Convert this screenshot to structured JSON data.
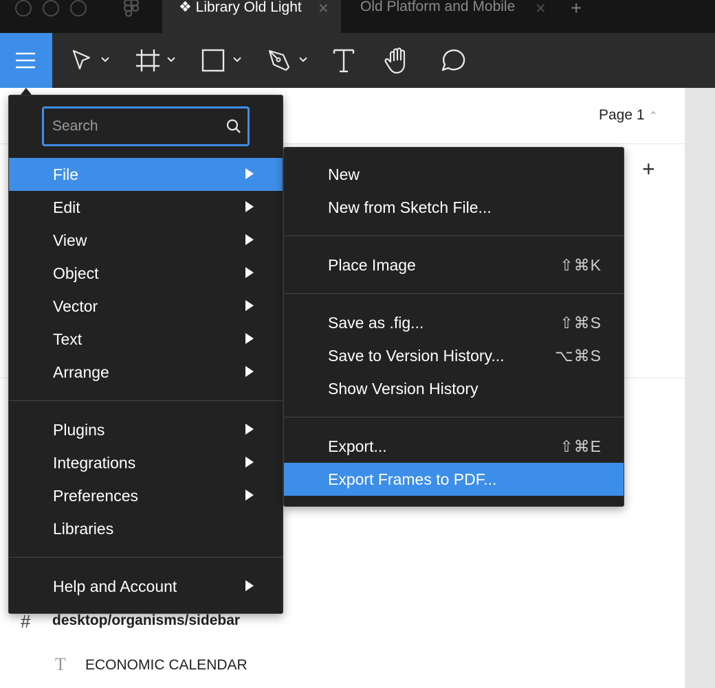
{
  "tabs": [
    {
      "label": "❖ Library Old Light",
      "active": true
    },
    {
      "label": "Old Platform and Mobile",
      "active": false
    }
  ],
  "tab_close_glyph": "✕",
  "new_tab_glyph": "+",
  "toolbar": {
    "tools": [
      "main-menu-icon",
      "move-tool-icon",
      "frame-tool-icon",
      "rectangle-tool-icon",
      "pen-tool-icon",
      "text-tool-icon",
      "hand-tool-icon",
      "comment-tool-icon"
    ],
    "text_tool_glyph": "T"
  },
  "pages": {
    "current": "Page 1",
    "caret": "⌃",
    "add_glyph": "+"
  },
  "search": {
    "placeholder": "Search"
  },
  "main_menu": {
    "groups": [
      [
        {
          "label": "File",
          "has_submenu": true,
          "active": true
        },
        {
          "label": "Edit",
          "has_submenu": true
        },
        {
          "label": "View",
          "has_submenu": true
        },
        {
          "label": "Object",
          "has_submenu": true
        },
        {
          "label": "Vector",
          "has_submenu": true
        },
        {
          "label": "Text",
          "has_submenu": true
        },
        {
          "label": "Arrange",
          "has_submenu": true
        }
      ],
      [
        {
          "label": "Plugins",
          "has_submenu": true
        },
        {
          "label": "Integrations",
          "has_submenu": true
        },
        {
          "label": "Preferences",
          "has_submenu": true
        },
        {
          "label": "Libraries",
          "has_submenu": false
        }
      ],
      [
        {
          "label": "Help and Account",
          "has_submenu": true
        }
      ]
    ]
  },
  "file_menu": {
    "groups": [
      [
        {
          "label": "New",
          "shortcut": ""
        },
        {
          "label": "New from Sketch File...",
          "shortcut": ""
        }
      ],
      [
        {
          "label": "Place Image",
          "shortcut": "⇧⌘K"
        }
      ],
      [
        {
          "label": "Save as .fig...",
          "shortcut": "⇧⌘S"
        },
        {
          "label": "Save to Version History...",
          "shortcut": "⌥⌘S"
        },
        {
          "label": "Show Version History",
          "shortcut": ""
        }
      ],
      [
        {
          "label": "Export...",
          "shortcut": "⇧⌘E"
        },
        {
          "label": "Export Frames to PDF...",
          "shortcut": "",
          "active": true
        }
      ]
    ]
  },
  "layers": {
    "frame": {
      "icon": "#",
      "label": "desktop/organisms/sidebar"
    },
    "text": {
      "icon": "T",
      "label": "ECONOMIC CALENDAR"
    }
  },
  "colors": {
    "accent": "#3d8ee8",
    "menu_bg": "#222222",
    "toolbar_bg": "#2c2c2c",
    "titlebar_bg": "#161616"
  }
}
